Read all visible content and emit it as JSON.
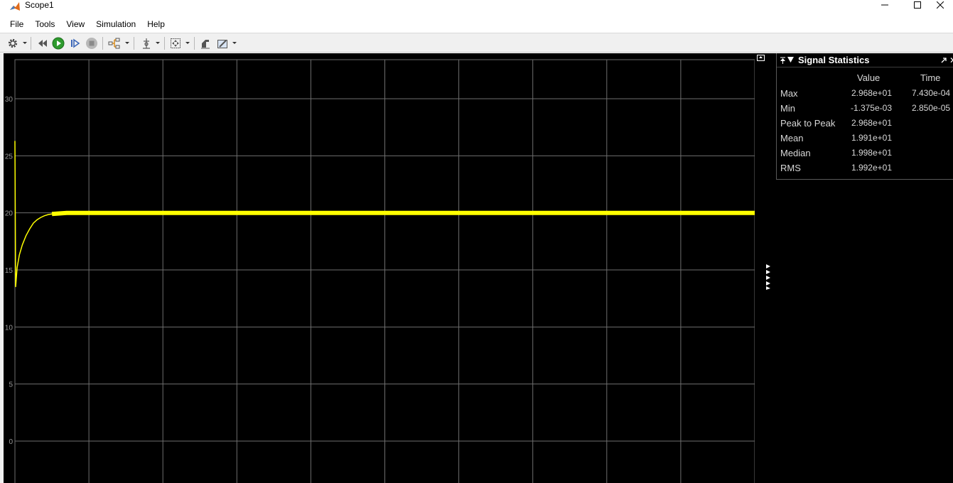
{
  "window": {
    "title": "Scope1",
    "controls": [
      "minimize",
      "maximize",
      "close"
    ]
  },
  "menu": [
    "File",
    "Tools",
    "View",
    "Simulation",
    "Help"
  ],
  "toolbar": {
    "icons": [
      "settings-gear-icon",
      "step-back-icon",
      "run-icon",
      "step-forward-icon",
      "stop-icon",
      "signal-select-icon",
      "cursor-measure-icon",
      "zoom-fit-icon",
      "style-icon",
      "highlight-icon"
    ]
  },
  "plot": {
    "background": "#000000",
    "grid_color": "#6e6e6e",
    "signal_color": "#ffff00",
    "y_tick_labels": [
      "30",
      "25",
      "20",
      "15",
      "10",
      "5",
      "0"
    ]
  },
  "chart_data": {
    "type": "line",
    "ylim": [
      -3.5,
      33.5
    ],
    "grid": true,
    "y_ticks": [
      0,
      5,
      10,
      15,
      20,
      25,
      30
    ],
    "series": [
      {
        "color": "#ffff00",
        "x": [
          0,
          0.1,
          0.3,
          0.6,
          1,
          1.5,
          2,
          2.5,
          3,
          3.5,
          4,
          4.5,
          5,
          6,
          7,
          8,
          9,
          10,
          12,
          15,
          20,
          30,
          40,
          50,
          60,
          70,
          80,
          90,
          100
        ],
        "values": [
          26.3,
          13.5,
          15.2,
          16.3,
          17.2,
          18.0,
          18.6,
          19.1,
          19.4,
          19.6,
          19.75,
          19.85,
          19.9,
          19.95,
          20.0,
          20.0,
          20.0,
          20.0,
          20.0,
          20.0,
          20.0,
          20.0,
          20.0,
          20.0,
          20.0,
          20.0,
          20.0,
          20.0,
          20.0
        ]
      }
    ]
  },
  "stats": {
    "title": "Signal Statistics",
    "col_value": "Value",
    "col_time": "Time",
    "rows": [
      {
        "label": "Max",
        "value": "2.968e+01",
        "time": "7.430e-04"
      },
      {
        "label": "Min",
        "value": "-1.375e-03",
        "time": "2.850e-05"
      },
      {
        "label": "Peak to Peak",
        "value": "2.968e+01",
        "time": ""
      },
      {
        "label": "Mean",
        "value": "1.991e+01",
        "time": ""
      },
      {
        "label": "Median",
        "value": "1.998e+01",
        "time": ""
      },
      {
        "label": "RMS",
        "value": "1.992e+01",
        "time": ""
      }
    ]
  }
}
